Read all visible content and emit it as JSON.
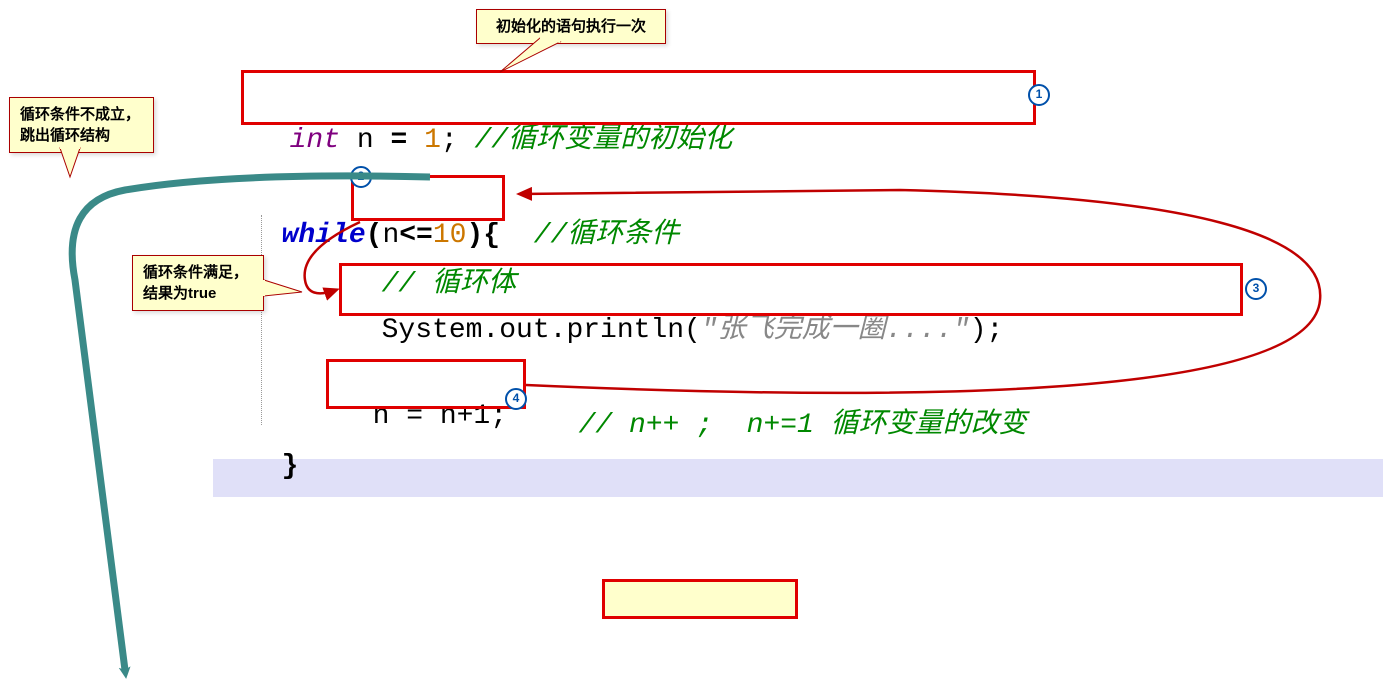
{
  "callouts": {
    "top": "初始化的语句执行一次",
    "left_top": "循环条件不成立，\n跳出循环结构",
    "left_mid": "循环条件满足，\n结果为true"
  },
  "code": {
    "line1_type": "int",
    "line1_var": " n ",
    "line1_op": "=",
    "line1_num": " 1",
    "line1_semi": "; ",
    "line1_cmt": "//循环变量的初始化",
    "line2_kw": "while",
    "line2_lp": "(",
    "line2_cond_var": "n",
    "line2_cond_op": "<=",
    "line2_cond_num": "10",
    "line2_rp": ")",
    "line2_brace": "{ ",
    "line2_cmt": " //循环条件",
    "line3_cmt": "// 循环体",
    "line4_call1": "System.out.println(",
    "line4_str": "\"张飞完成一圈....\"",
    "line4_call2": ");",
    "line5_stmt": "n = n+1;",
    "line5_cmt": "// n++ ;  n+=1 循环变量的改变",
    "line6_brace": "}"
  },
  "badges": [
    "1",
    "2",
    "3",
    "4"
  ]
}
